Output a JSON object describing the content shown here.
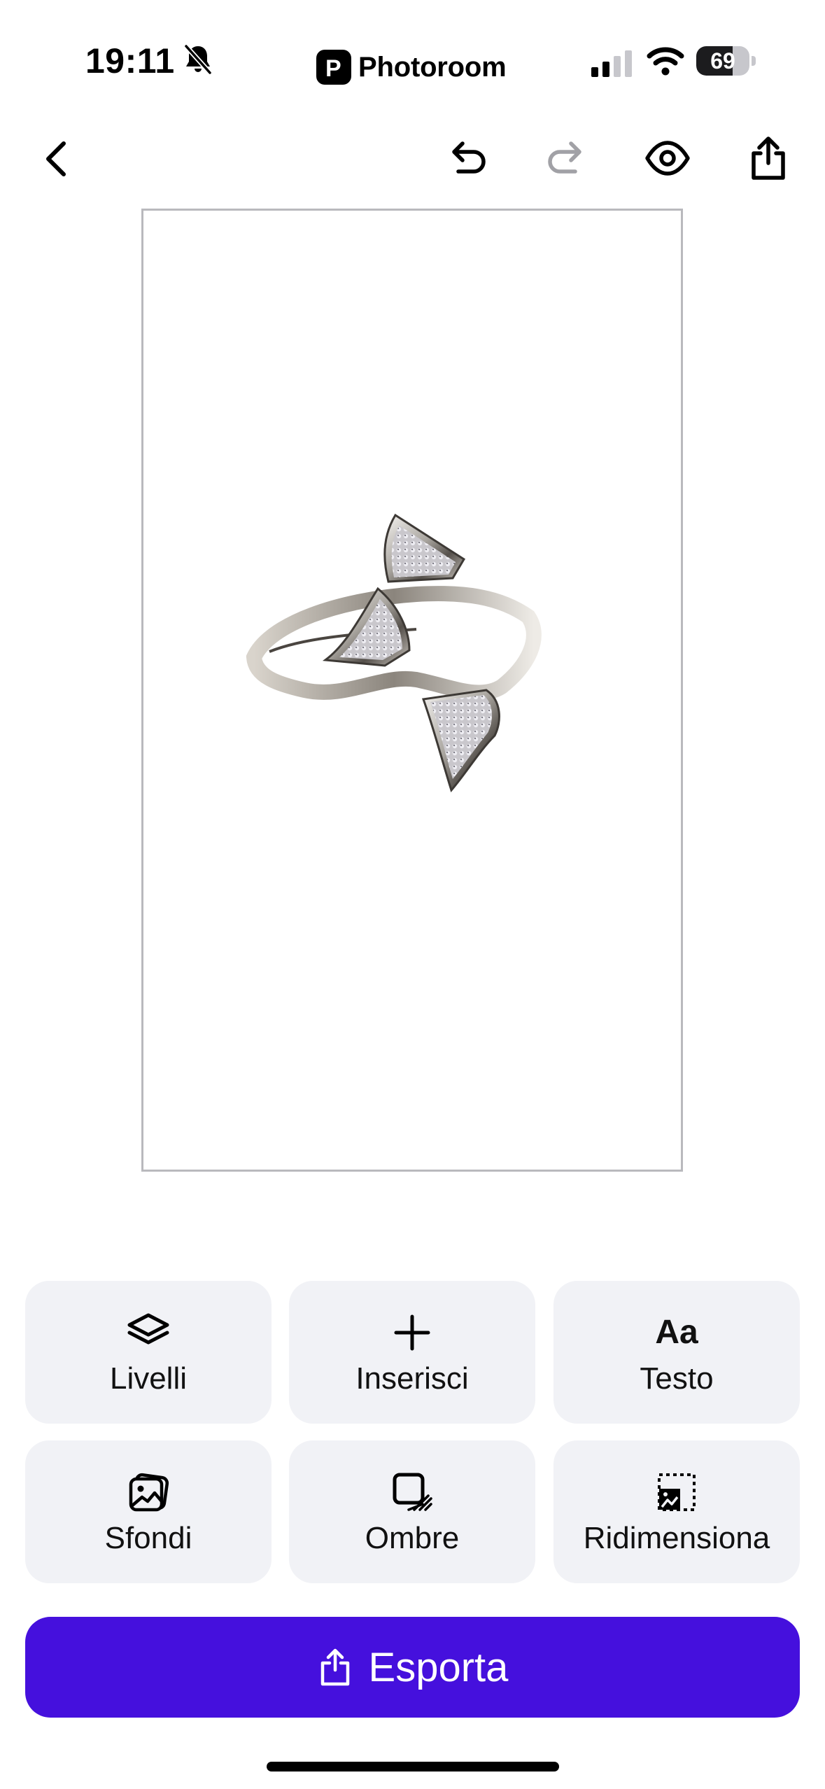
{
  "status_bar": {
    "time": "19:11",
    "app_name": "Photoroom",
    "app_logo_letter": "P",
    "battery_level": "69",
    "battery_fraction": 0.69,
    "silent_mode_icon": "bell-slash-icon",
    "signal_icon": "cellular-signal-icon",
    "wifi_icon": "wifi-icon"
  },
  "toolbar": {
    "back_icon": "chevron-left-icon",
    "undo_icon": "undo-icon",
    "redo_icon": "redo-icon",
    "redo_enabled": false,
    "preview_icon": "eye-icon",
    "share_icon": "share-icon"
  },
  "canvas": {
    "subject": "ring-product-image",
    "background_color": "#ffffff"
  },
  "tools": [
    {
      "label": "Livelli",
      "icon": "layers-icon"
    },
    {
      "label": "Inserisci",
      "icon": "plus-icon"
    },
    {
      "label": "Testo",
      "icon": "text-icon",
      "glyph": "Aa"
    },
    {
      "label": "Sfondi",
      "icon": "backgrounds-icon"
    },
    {
      "label": "Ombre",
      "icon": "shadow-icon"
    },
    {
      "label": "Ridimensiona",
      "icon": "resize-icon"
    }
  ],
  "export_button": {
    "label": "Esporta",
    "icon": "share-icon"
  },
  "colors": {
    "accent": "#4510dd",
    "tool_background": "#f1f2f6",
    "disabled_icon": "#a1a1a6",
    "canvas_border": "#b9b9bd"
  }
}
